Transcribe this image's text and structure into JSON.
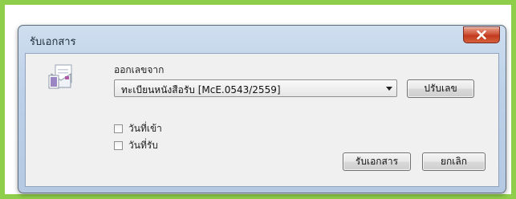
{
  "dialog": {
    "title": "รับเอกสาร",
    "close_icon": "close-icon",
    "doc_icon": "document-envelope-icon"
  },
  "issue": {
    "label": "ออกเลขจาก",
    "selected": "ทะเบียนหนังสือรับ [McE.0543/2559]",
    "adjust_button": "ปรับเลข"
  },
  "checkboxes": [
    {
      "label": "วันที่เข้า",
      "checked": false
    },
    {
      "label": "วันที่รับ",
      "checked": false
    }
  ],
  "buttons": {
    "receive": "รับเอกสาร",
    "cancel": "ยกเลิก"
  },
  "colors": {
    "frame_border": "#8fce4a",
    "close_button": "#c1391e"
  }
}
